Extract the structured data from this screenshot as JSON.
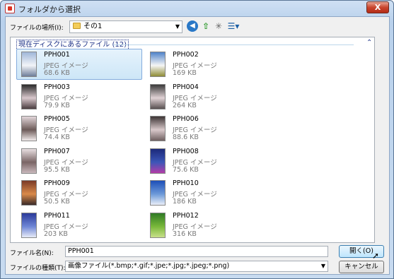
{
  "window": {
    "title": "フォルダから選択",
    "close_label": "X"
  },
  "toolbar": {
    "lookin_label": "ファイルの場所(I):",
    "lookin_value": "その1",
    "back_icon": "back-arrow-icon",
    "up_icon": "up-folder-icon",
    "new_folder_icon": "new-folder-icon",
    "views_icon": "views-menu-icon"
  },
  "group": {
    "header": "現在ディスクにあるファイル (12)"
  },
  "files": [
    {
      "name": "PPH001",
      "type": "JPEG イメージ",
      "size": "68.6 KB",
      "selected": true,
      "colors": [
        "#9fb7d9",
        "#f2f4f8",
        "#6f7e9a"
      ]
    },
    {
      "name": "PPH002",
      "type": "JPEG イメージ",
      "size": "169 KB",
      "selected": false,
      "colors": [
        "#4f83c9",
        "#f5f5f5",
        "#8e8c36"
      ]
    },
    {
      "name": "PPH003",
      "type": "JPEG イメージ",
      "size": "79.9 KB",
      "selected": false,
      "colors": [
        "#2a2a2a",
        "#d8c7cc",
        "#4a3d3f"
      ]
    },
    {
      "name": "PPH004",
      "type": "JPEG イメージ",
      "size": "264 KB",
      "selected": false,
      "colors": [
        "#3a3a3a",
        "#e0d2d5",
        "#585050"
      ]
    },
    {
      "name": "PPH005",
      "type": "JPEG イメージ",
      "size": "74.4 KB",
      "selected": false,
      "colors": [
        "#e3d7da",
        "#6c5a58",
        "#f2ecec"
      ]
    },
    {
      "name": "PPH006",
      "type": "JPEG イメージ",
      "size": "88.6 KB",
      "selected": false,
      "colors": [
        "#3d3535",
        "#d9c9cb",
        "#6f6060"
      ]
    },
    {
      "name": "PPH007",
      "type": "JPEG イメージ",
      "size": "95.5 KB",
      "selected": false,
      "colors": [
        "#e8dfe1",
        "#7a6565",
        "#c9b8bc"
      ]
    },
    {
      "name": "PPH008",
      "type": "JPEG イメージ",
      "size": "75.6 KB",
      "selected": false,
      "colors": [
        "#1c2a7a",
        "#3c56b8",
        "#b43da8"
      ]
    },
    {
      "name": "PPH009",
      "type": "JPEG イメージ",
      "size": "50.5 KB",
      "selected": false,
      "colors": [
        "#7a3b28",
        "#d98a4a",
        "#3a2a28"
      ]
    },
    {
      "name": "PPH010",
      "type": "JPEG イメージ",
      "size": "186 KB",
      "selected": false,
      "colors": [
        "#1d4fb8",
        "#6c99d8",
        "#e9eef8"
      ]
    },
    {
      "name": "PPH011",
      "type": "JPEG イメージ",
      "size": "203 KB",
      "selected": false,
      "colors": [
        "#2a3a9a",
        "#6f86d6",
        "#e7ebf7"
      ]
    },
    {
      "name": "PPH012",
      "type": "JPEG イメージ",
      "size": "316 KB",
      "selected": false,
      "colors": [
        "#2f7a25",
        "#79b83a",
        "#c8e08a"
      ]
    }
  ],
  "bottom": {
    "filename_label": "ファイル名(N):",
    "filename_value": "PPH001",
    "filetype_label": "ファイルの種類(T):",
    "filetype_value": "画像ファイル(*.bmp;*.gif;*.jpe;*.jpg;*.jpeg;*.png)",
    "open_label": "開く(O)",
    "cancel_label": "キャンセル"
  }
}
